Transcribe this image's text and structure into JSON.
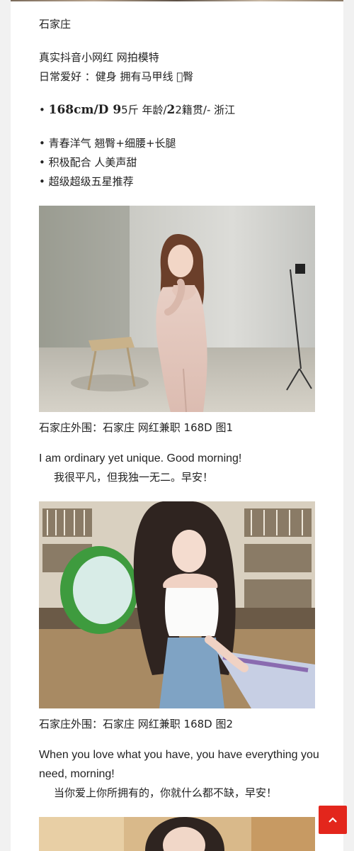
{
  "post": {
    "city": "石家庄",
    "intro_line1": "真实抖音小网红 网拍模特",
    "intro_line2": "日常爱好 ：健身 拥有马甲线 &#xe000;臀",
    "stats_prefix": "• ",
    "stats_bold1": "168cm/D 9",
    "stats_mid1": "5斤 年龄/",
    "stats_bold2": "2",
    "stats_mid2": "2籍贯/- 浙江",
    "bullets": [
      "• 青春洋气 翘臀+细腰+长腿",
      "• 积极配合 人美声甜",
      "• 超级超级五星推荐"
    ]
  },
  "images": [
    {
      "caption": "石家庄外围：石家庄 网红兼职 168D 图1",
      "quote_en": "I am ordinary yet unique. Good morning!",
      "quote_zh": "我很平凡，但我独一无二。早安！"
    },
    {
      "caption": "石家庄外围：石家庄 网红兼职 168D 图2",
      "quote_en": "When you love what you have, you have everything you need, morning!",
      "quote_zh": "当你爱上你所拥有的，你就什么都不缺，早安！"
    }
  ],
  "scroll_top": {
    "icon": "chevron-up-icon",
    "color": "#e3261c"
  }
}
